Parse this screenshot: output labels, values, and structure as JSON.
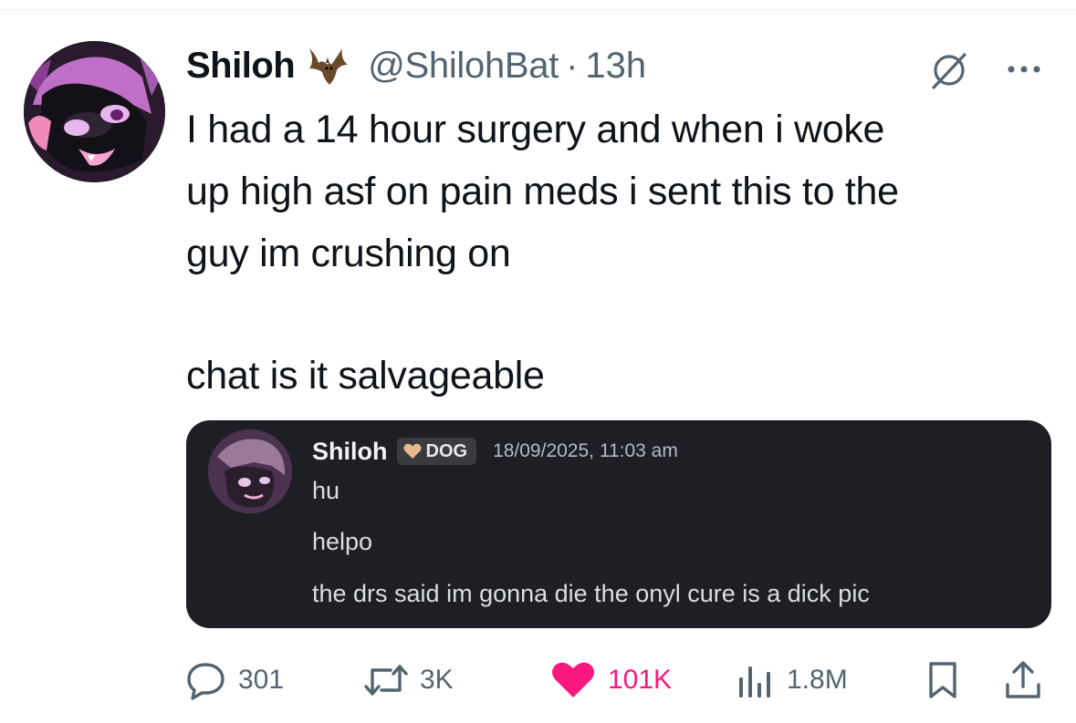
{
  "tweet": {
    "display_name": "Shiloh",
    "badge_icon": "bat-emoji-icon",
    "handle": "@ShilohBat",
    "separator": "·",
    "time": "13h",
    "text_lines": [
      "I had a 14 hour surgery and when i woke",
      "up high asf on pain meds i sent this to the",
      "guy im crushing on",
      "chat is it salvageable"
    ]
  },
  "embed": {
    "name": "Shiloh",
    "tag": "DOG",
    "timestamp": "18/09/2025, 11:03 am",
    "messages": [
      "hu",
      "helpo",
      "the drs said im gonna die the onyl cure is a dick pic"
    ]
  },
  "actions": {
    "replies": "301",
    "reposts": "3K",
    "likes": "101K",
    "views": "1.8M"
  },
  "colors": {
    "text": "#0f1419",
    "secondary": "#536471",
    "like": "#f91880",
    "embed_bg": "#1e1f24"
  }
}
